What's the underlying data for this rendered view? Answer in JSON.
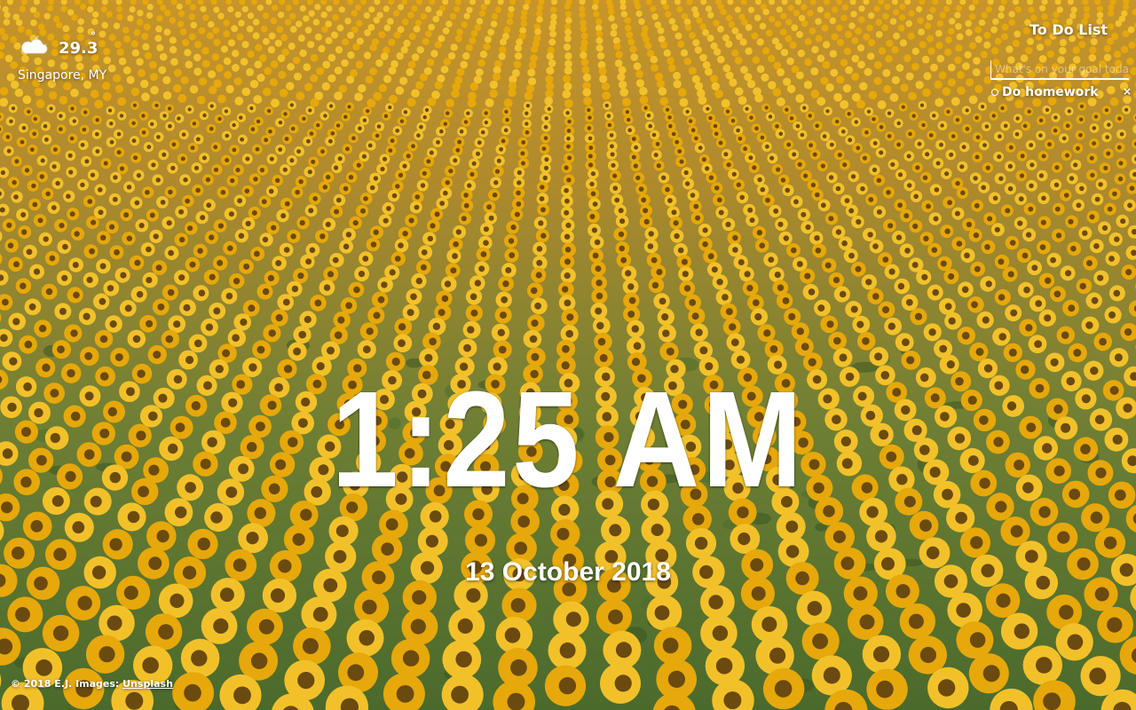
{
  "background": {
    "description": "",
    "colors": {
      "petal": "#e6a80a",
      "petal_light": "#f2c12a",
      "center": "#6b4a10",
      "foliage": "#4f6e2c",
      "foliage_dark": "#3a5622"
    }
  },
  "weather": {
    "icon": "partly-cloudy-night-icon",
    "temperature": "29.3",
    "degree_symbol": "°",
    "location": "Singapore, MY"
  },
  "todo": {
    "title": "To Do List",
    "input_placeholder": "What's on your goal today?",
    "items": [
      {
        "label": "Do homework",
        "delete_label": "×"
      }
    ]
  },
  "clock": {
    "time": "1:25 AM",
    "date": "13 October 2018"
  },
  "footer": {
    "copyright": "© 2018 E.J. Images: ",
    "link_label": "Unsplash"
  }
}
